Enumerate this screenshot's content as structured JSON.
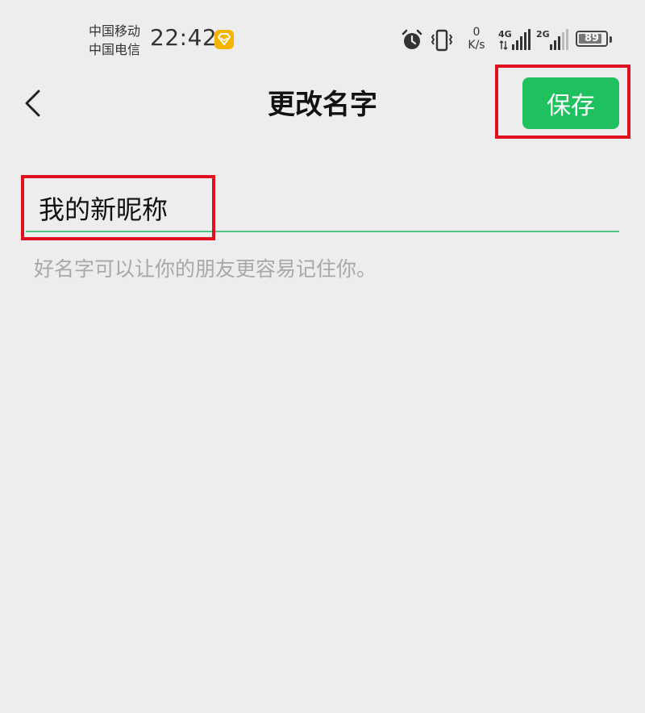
{
  "status_bar": {
    "carrier_1": "中国移动",
    "carrier_2": "中国电信",
    "time": "22:42",
    "net_speed_value": "0",
    "net_speed_unit": "K/s",
    "signal_1_label": "4G",
    "signal_2_label": "2G",
    "battery_level": "89",
    "battery_fraction": 0.89,
    "icons": [
      "app-badge-icon",
      "alarm-icon",
      "vibrate-icon",
      "signal-icon",
      "battery-icon"
    ]
  },
  "header": {
    "title": "更改名字",
    "save_label": "保存",
    "back_icon": "chevron-left-icon"
  },
  "form": {
    "name_value": "我的新昵称",
    "hint": "好名字可以让你的朋友更容易记住你。"
  },
  "colors": {
    "accent": "#1fc15f",
    "underline": "#4cc586",
    "highlight": "#e01020",
    "background": "#ededed",
    "hint": "#a8a8a8"
  }
}
